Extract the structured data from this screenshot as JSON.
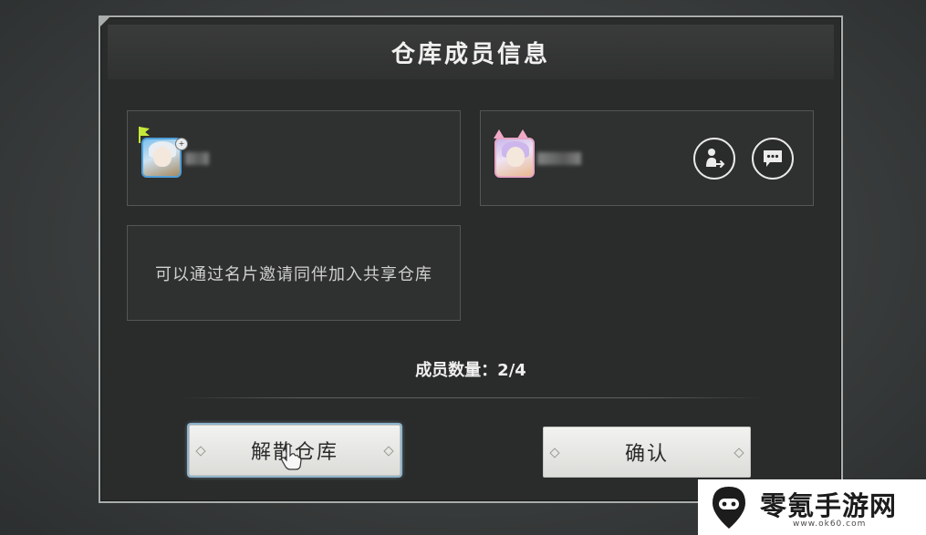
{
  "dialog": {
    "title": "仓库成员信息"
  },
  "members": [
    {
      "avatar": "character-avatar-silver-hair",
      "name": "",
      "is_owner": true,
      "badge_icon": "owner-flag-icon"
    },
    {
      "avatar": "character-avatar-lilac-hair",
      "name": "",
      "is_owner": false,
      "actions": [
        {
          "icon": "transfer-user-icon",
          "label": ""
        },
        {
          "icon": "chat-bubble-icon",
          "label": ""
        }
      ]
    }
  ],
  "invite_hint": "可以通过名片邀请同伴加入共享仓库",
  "member_count_label": "成员数量：2/4",
  "buttons": {
    "disband": "解散仓库",
    "confirm": "确认"
  },
  "watermark": {
    "title": "零氪手游网",
    "url": "www.ok60.com"
  },
  "colors": {
    "owner_flag": "#c6e83a",
    "selected_outline": "#8fb5cc",
    "button_face": "#ececea"
  }
}
